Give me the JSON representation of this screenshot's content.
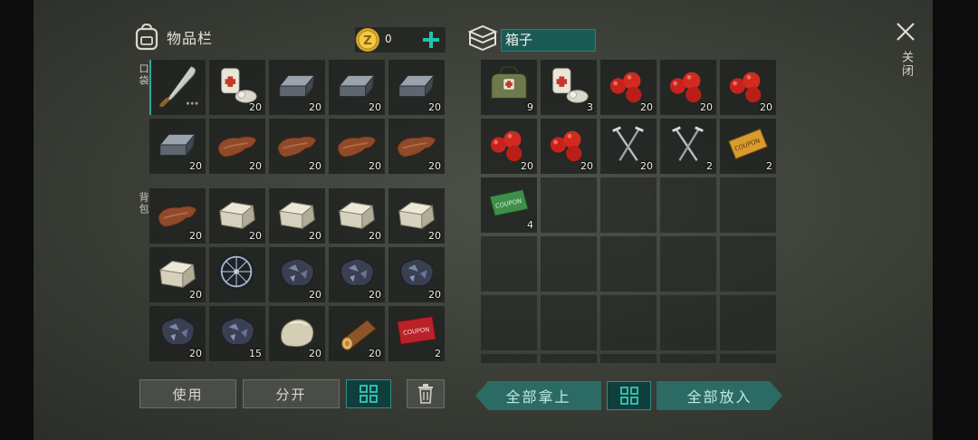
{
  "inventory": {
    "title": "物品栏",
    "coins": "0",
    "pocket_label": "口袋",
    "backpack_label": "背包",
    "pocket_slots": [
      {
        "icon": "machete-icon",
        "count": ""
      },
      {
        "icon": "bandage-icon",
        "count": "20"
      },
      {
        "icon": "iron-ingot-icon",
        "count": "20"
      },
      {
        "icon": "iron-ingot-icon",
        "count": "20"
      },
      {
        "icon": "iron-ingot-icon",
        "count": "20"
      },
      {
        "icon": "iron-ingot-icon",
        "count": "20"
      },
      {
        "icon": "leather-icon",
        "count": "20"
      },
      {
        "icon": "leather-icon",
        "count": "20"
      },
      {
        "icon": "leather-icon",
        "count": "20"
      },
      {
        "icon": "leather-icon",
        "count": "20"
      }
    ],
    "backpack_slots": [
      {
        "icon": "leather-icon",
        "count": "20"
      },
      {
        "icon": "stone-block-icon",
        "count": "20"
      },
      {
        "icon": "stone-block-icon",
        "count": "20"
      },
      {
        "icon": "stone-block-icon",
        "count": "20"
      },
      {
        "icon": "stone-block-icon",
        "count": "20"
      },
      {
        "icon": "stone-block-icon",
        "count": "20"
      },
      {
        "icon": "wheel-icon",
        "count": ""
      },
      {
        "icon": "iron-ore-icon",
        "count": "20"
      },
      {
        "icon": "iron-ore-icon",
        "count": "20"
      },
      {
        "icon": "iron-ore-icon",
        "count": "20"
      },
      {
        "icon": "iron-ore-icon",
        "count": "20"
      },
      {
        "icon": "iron-ore-icon",
        "count": "15"
      },
      {
        "icon": "stone-icon",
        "count": "20"
      },
      {
        "icon": "wood-log-icon",
        "count": "20"
      },
      {
        "icon": "red-coupon-icon",
        "count": "2"
      }
    ],
    "buttons": {
      "use": "使用",
      "split": "分开"
    }
  },
  "box": {
    "title": "箱子",
    "slots": [
      {
        "icon": "medkit-bag-icon",
        "count": "9"
      },
      {
        "icon": "bandage-icon",
        "count": "3"
      },
      {
        "icon": "tomato-icon",
        "count": "20"
      },
      {
        "icon": "tomato-icon",
        "count": "20"
      },
      {
        "icon": "tomato-icon",
        "count": "20"
      },
      {
        "icon": "tomato-icon",
        "count": "20"
      },
      {
        "icon": "tomato-icon",
        "count": "20"
      },
      {
        "icon": "nails-icon",
        "count": "20"
      },
      {
        "icon": "nails-icon",
        "count": "2"
      },
      {
        "icon": "orange-coupon-icon",
        "count": "2"
      },
      {
        "icon": "green-coupon-icon",
        "count": "4"
      }
    ],
    "total_rows": 6,
    "buttons": {
      "take_all": "全部拿上",
      "put_all": "全部放入"
    }
  },
  "close_label": "关闭",
  "colors": {
    "accent": "#2f8f86",
    "coin": "#e0b43a",
    "plus": "#23c4a9"
  }
}
